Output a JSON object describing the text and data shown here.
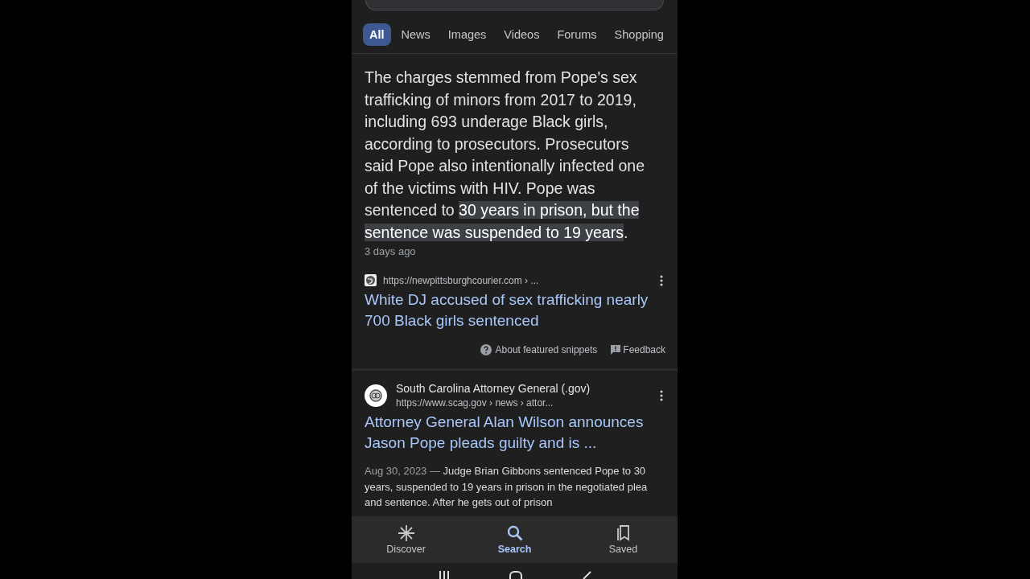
{
  "tabs": [
    {
      "label": "All",
      "selected": true
    },
    {
      "label": "News",
      "selected": false
    },
    {
      "label": "Images",
      "selected": false
    },
    {
      "label": "Videos",
      "selected": false
    },
    {
      "label": "Forums",
      "selected": false
    },
    {
      "label": "Shopping",
      "selected": false
    }
  ],
  "featured_snippet": {
    "text": "The charges stemmed from Pope's sex trafficking of minors from 2017 to 2019, including 693 underage Black girls, according to prosecutors. Prosecutors said Pope also intentionally infected one of the victims with HIV. Pope was sentenced to **30 years in prison, but the sentence was suspended to 19 years**.",
    "date": "3 days ago",
    "url": "https://newpittsburghcourier.com › ...",
    "title": "White DJ accused of sex trafficking nearly 700 Black girls sentenced",
    "about": "About featured snippets",
    "feedback": "Feedback"
  },
  "results": [
    {
      "site": "South Carolina Attorney General (.gov)",
      "url": "https://www.scag.gov › news › attor...",
      "title": "Attorney General Alan Wilson announces Jason Pope pleads guilty and is ...",
      "date": "Aug 30, 2023 —",
      "snippet": "Judge Brian Gibbons sentenced Pope to 30 years, suspended to 19 years in prison in the negotiated plea and sentence. After he gets out of prison"
    }
  ],
  "bottom_nav": [
    {
      "label": "Discover",
      "kind": "discover",
      "selected": false
    },
    {
      "label": "Search",
      "kind": "search",
      "selected": true
    },
    {
      "label": "Saved",
      "kind": "saved",
      "selected": false
    }
  ]
}
